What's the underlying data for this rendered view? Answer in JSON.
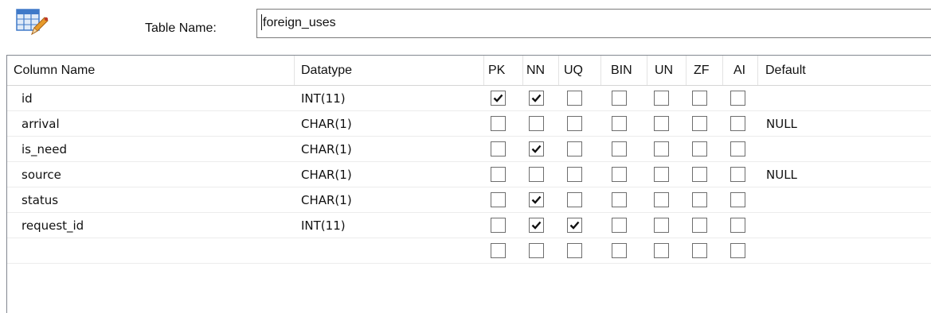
{
  "header": {
    "table_name_label": "Table Name:",
    "table_name_value": "foreign_uses"
  },
  "grid": {
    "columns": [
      "Column Name",
      "Datatype",
      "PK",
      "NN",
      "UQ",
      "BIN",
      "UN",
      "ZF",
      "AI",
      "Default"
    ],
    "rows": [
      {
        "name": "id",
        "datatype": "INT(11)",
        "pk": true,
        "nn": true,
        "uq": false,
        "bin": false,
        "un": false,
        "zf": false,
        "ai": false,
        "default": ""
      },
      {
        "name": "arrival",
        "datatype": "CHAR(1)",
        "pk": false,
        "nn": false,
        "uq": false,
        "bin": false,
        "un": false,
        "zf": false,
        "ai": false,
        "default": "NULL"
      },
      {
        "name": "is_need",
        "datatype": "CHAR(1)",
        "pk": false,
        "nn": true,
        "uq": false,
        "bin": false,
        "un": false,
        "zf": false,
        "ai": false,
        "default": ""
      },
      {
        "name": "source",
        "datatype": "CHAR(1)",
        "pk": false,
        "nn": false,
        "uq": false,
        "bin": false,
        "un": false,
        "zf": false,
        "ai": false,
        "default": "NULL"
      },
      {
        "name": "status",
        "datatype": "CHAR(1)",
        "pk": false,
        "nn": true,
        "uq": false,
        "bin": false,
        "un": false,
        "zf": false,
        "ai": false,
        "default": ""
      },
      {
        "name": "request_id",
        "datatype": "INT(11)",
        "pk": false,
        "nn": true,
        "uq": true,
        "bin": false,
        "un": false,
        "zf": false,
        "ai": false,
        "default": ""
      },
      {
        "name": "",
        "datatype": "",
        "pk": false,
        "nn": false,
        "uq": false,
        "bin": false,
        "un": false,
        "zf": false,
        "ai": false,
        "default": ""
      }
    ]
  },
  "icons": {
    "table_icon": "table-edit-icon",
    "checkmark": "check-icon"
  },
  "colors": {
    "border": "#828790",
    "checkbox_border": "#6e6e6e",
    "icon_blue": "#3f79c8",
    "icon_orange": "#e79b2b"
  }
}
